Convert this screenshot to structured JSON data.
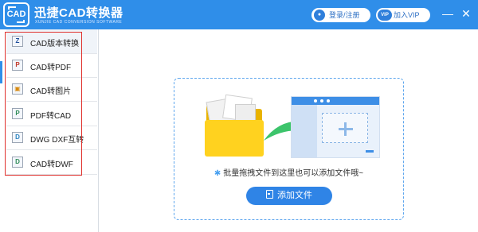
{
  "app": {
    "logo_text": "CAD",
    "title": "迅捷CAD转换器",
    "subtitle": "XUNJIE CAD CONVERSION SOFTWARE"
  },
  "toolbar": {
    "login_label": "登录/注册",
    "vip_badge": "VIP",
    "vip_label": "加入VIP",
    "minimize_glyph": "—",
    "close_glyph": "✕"
  },
  "sidebar": {
    "items": [
      {
        "label": "CAD版本转换",
        "icon": "cad-version-icon",
        "color": "#1e4f9c"
      },
      {
        "label": "CAD转PDF",
        "icon": "cad-to-pdf-icon",
        "color": "#c0392b"
      },
      {
        "label": "CAD转图片",
        "icon": "cad-to-image-icon",
        "color": "#d68910"
      },
      {
        "label": "PDF转CAD",
        "icon": "pdf-to-cad-icon",
        "color": "#2e8b57"
      },
      {
        "label": "DWG DXF互转",
        "icon": "dwg-dxf-icon",
        "color": "#2e86c1"
      },
      {
        "label": "CAD转DWF",
        "icon": "cad-to-dwf-icon",
        "color": "#2e8b57"
      }
    ]
  },
  "dropzone": {
    "hint": "批量拖拽文件到这里也可以添加文件哦~",
    "add_button": "添加文件"
  },
  "colors": {
    "accent": "#2f8ee9",
    "highlight_box": "#e0322e",
    "folder": "#ffd21f",
    "arrow": "#3cc46b"
  }
}
